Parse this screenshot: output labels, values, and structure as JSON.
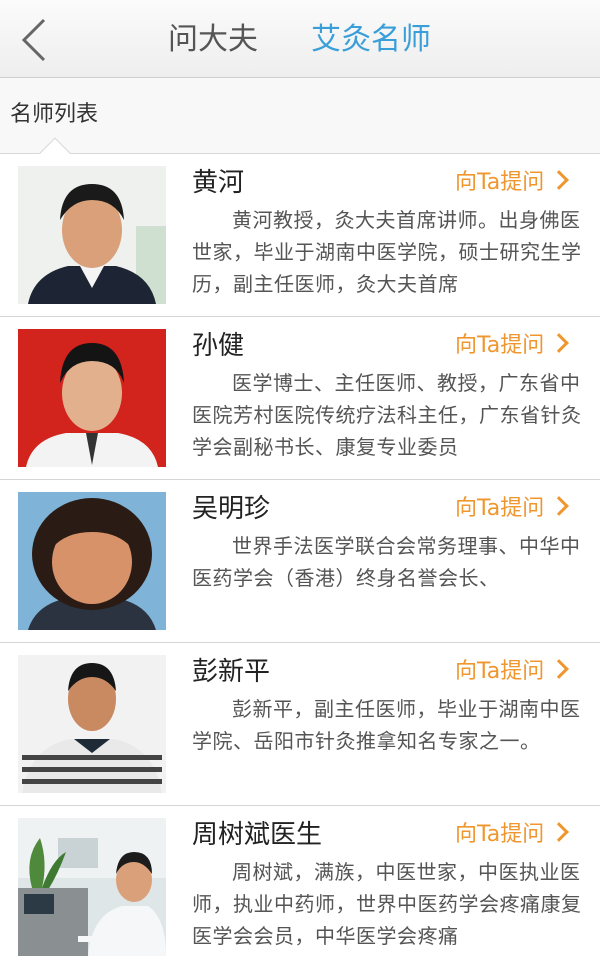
{
  "header": {
    "tabs": [
      {
        "label": "问大夫"
      },
      {
        "label": "艾灸名师"
      }
    ]
  },
  "section": {
    "title": "名师列表"
  },
  "ask_label": "向Ta提问",
  "colors": {
    "accent_blue": "#3a9fd8",
    "accent_orange": "#f0962e"
  },
  "doctors": [
    {
      "name": "黄河",
      "desc": "黄河教授，灸大夫首席讲师。出身佛医世家，毕业于湖南中医学院，硕士研究生学历，副主任医师，灸大夫首席"
    },
    {
      "name": "孙健",
      "desc": "医学博士、主任医师、教授，广东省中医院芳村医院传统疗法科主任，广东省针灸学会副秘书长、康复专业委员"
    },
    {
      "name": "吴明珍",
      "desc": "世界手法医学联合会常务理事、中华中医药学会（香港）终身名誉会长、"
    },
    {
      "name": "彭新平",
      "desc": "彭新平，副主任医师，毕业于湖南中医学院、岳阳市针灸推拿知名专家之一。"
    },
    {
      "name": "周树斌医生",
      "desc": "周树斌，满族，中医世家，中医执业医师，执业中药师，世界中医药学会疼痛康复医学会会员，中华医学会疼痛"
    }
  ]
}
